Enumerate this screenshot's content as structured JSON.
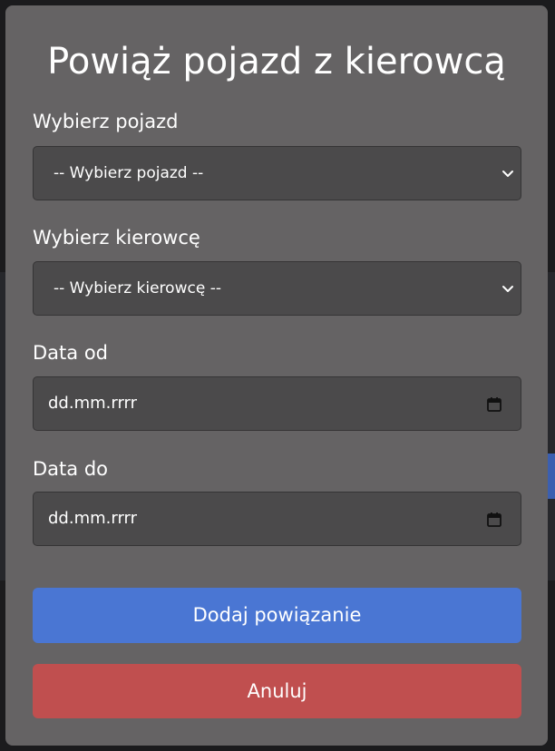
{
  "modal": {
    "title": "Powiąż pojazd z kierowcą",
    "vehicle": {
      "label": "Wybierz pojazd",
      "selected": "-- Wybierz pojazd --"
    },
    "driver": {
      "label": "Wybierz kierowcę",
      "selected": "-- Wybierz kierowcę --"
    },
    "date_from": {
      "label": "Data od",
      "value": "dd.mm.rrrr"
    },
    "date_to": {
      "label": "Data do",
      "value": "dd.mm.rrrr"
    },
    "submit_label": "Dodaj powiązanie",
    "cancel_label": "Anuluj"
  },
  "colors": {
    "modal_bg": "#656364",
    "field_bg": "#4b4a4b",
    "primary": "#4a76d3",
    "danger": "#c04f4f",
    "text": "#ffffff"
  },
  "icons": {
    "select_arrow": "chevron-down-icon",
    "date_picker": "calendar-icon"
  }
}
